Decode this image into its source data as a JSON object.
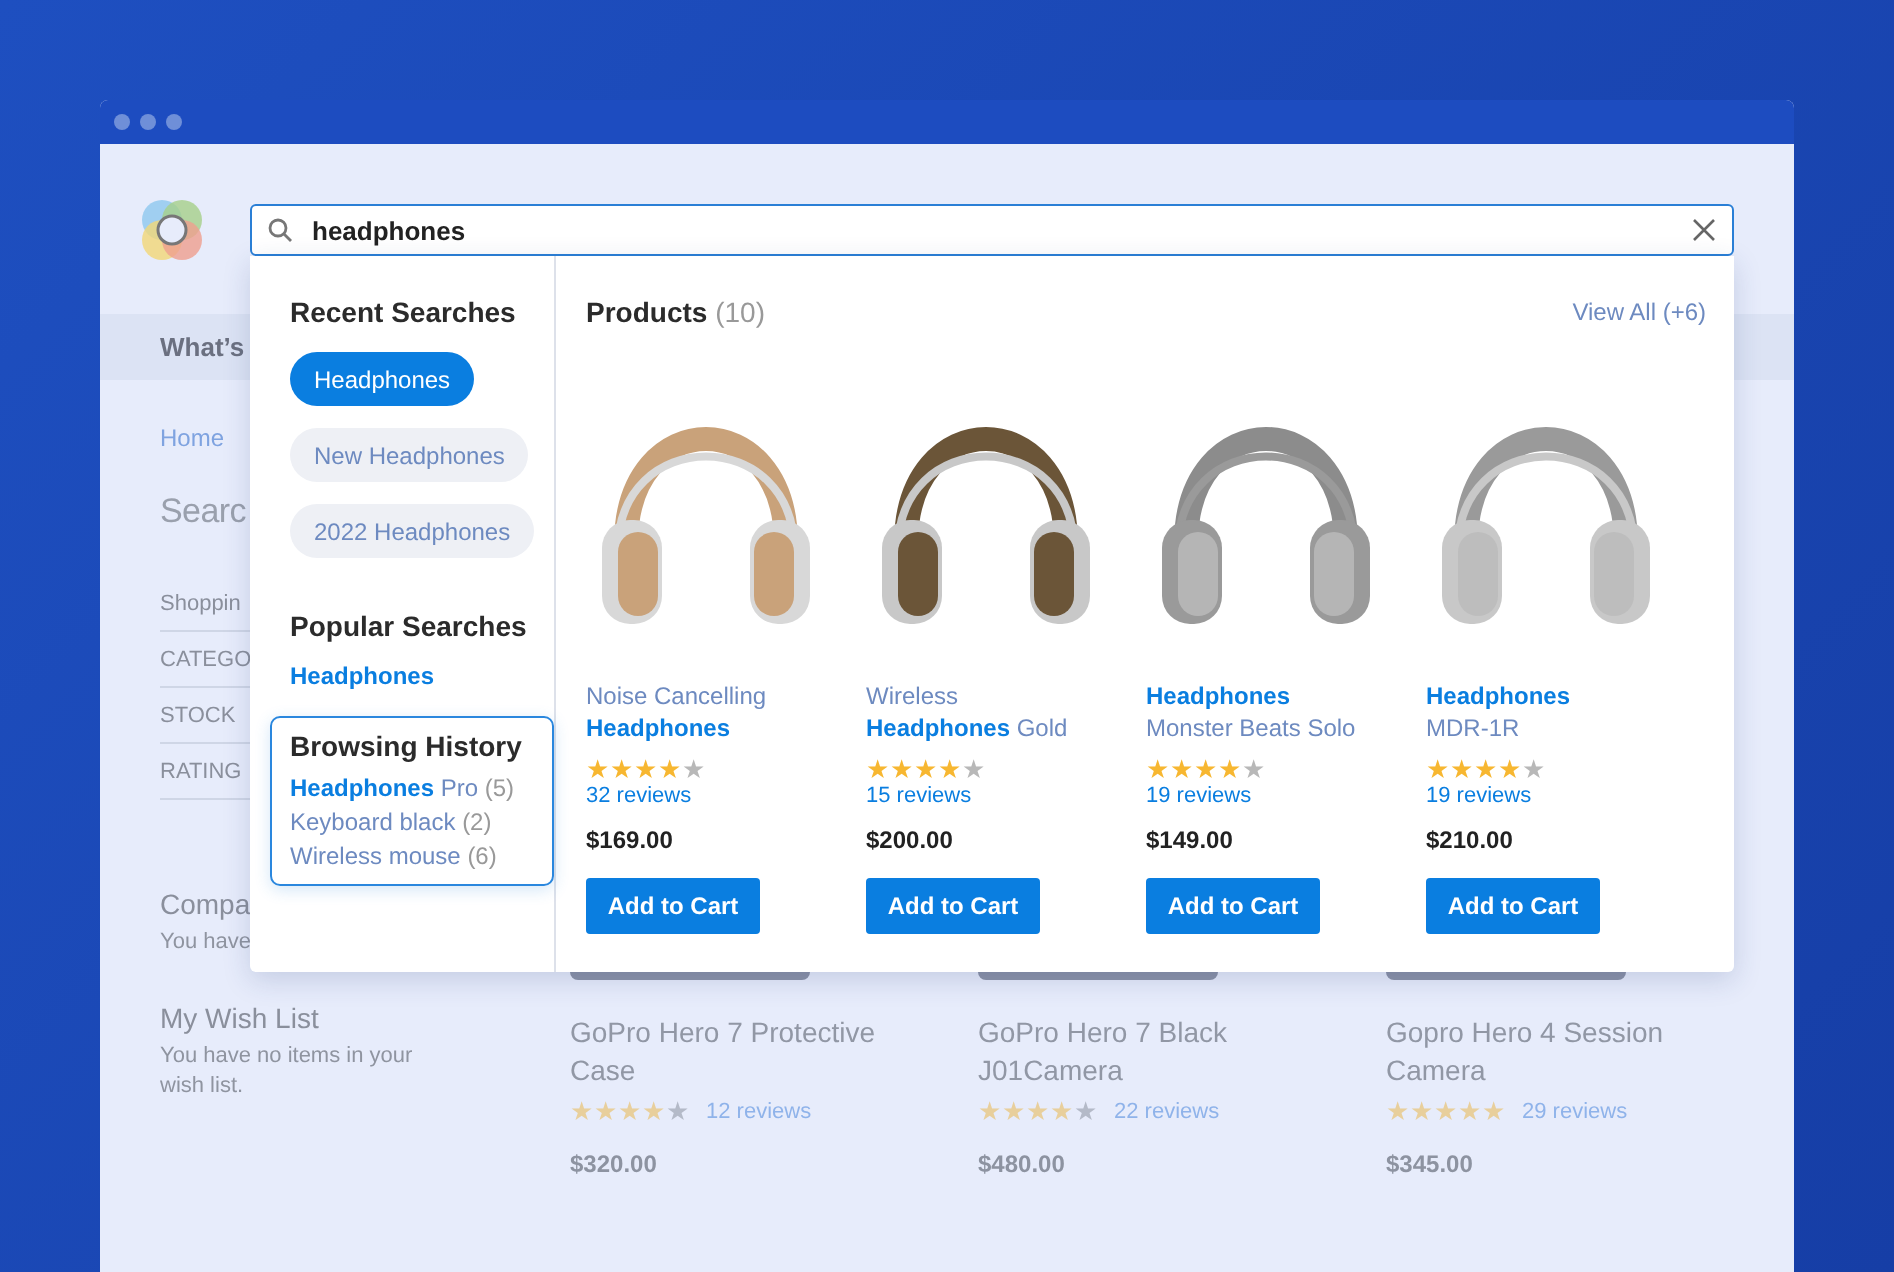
{
  "nav": {
    "label": "What’s"
  },
  "search": {
    "value": "headphones"
  },
  "page": {
    "breadcrumb": "Home",
    "title": "Searc",
    "filters": [
      "Shoppin",
      "CATEGO",
      "STOCK",
      "RATING"
    ],
    "compare": {
      "title": "Compa",
      "text": "You have"
    },
    "wishlist": {
      "title": "My Wish List",
      "text": "You have no items in your wish list."
    },
    "products": [
      {
        "name": "GoPro Hero 7 Protective\nCase",
        "stars": 4,
        "reviews": "12 reviews",
        "price": "$320.00"
      },
      {
        "name": "GoPro Hero 7 Black\nJ01Camera",
        "stars": 4,
        "reviews": "22 reviews",
        "price": "$480.00"
      },
      {
        "name": "Gopro Hero 4 Session\nCamera",
        "stars": 5,
        "reviews": "29 reviews",
        "price": "$345.00"
      }
    ]
  },
  "dropdown": {
    "recent": {
      "title": "Recent Searches",
      "items": [
        {
          "label": "Headphones",
          "selected": true
        },
        {
          "label": "New Headphones",
          "selected": false
        },
        {
          "label": "2022 Headphones",
          "selected": false
        }
      ]
    },
    "popular": {
      "title": "Popular Searches",
      "items": [
        "Headphones"
      ]
    },
    "history": {
      "title": "Browsing History",
      "items": [
        {
          "label": "**Headphones** Pro",
          "count": "(5)"
        },
        {
          "label": "Keyboard black",
          "count": "(2)"
        },
        {
          "label": "Wireless mouse",
          "count": "(6)"
        }
      ]
    },
    "products": {
      "title": "Products",
      "count": "(10)",
      "view_all": "View All (+6)",
      "items": [
        {
          "name": "Noise Cancelling\n**Headphones**",
          "stars": 4,
          "reviews": "32 reviews",
          "price": "$169.00",
          "button": "Add to Cart"
        },
        {
          "name": "Wireless\n**Headphones** Gold",
          "stars": 4,
          "reviews": "15 reviews",
          "price": "$200.00",
          "button": "Add to Cart"
        },
        {
          "name": "**Headphones**\nMonster Beats Solo",
          "stars": 4,
          "reviews": "19 reviews",
          "price": "$149.00",
          "button": "Add to Cart"
        },
        {
          "name": "**Headphones**\nMDR-1R",
          "stars": 4,
          "reviews": "19 reviews",
          "price": "$210.00",
          "button": "Add to Cart"
        }
      ]
    }
  }
}
